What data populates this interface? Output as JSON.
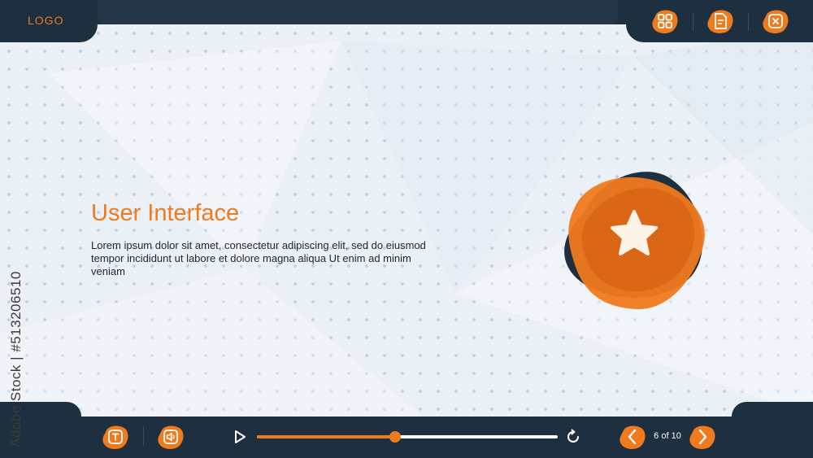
{
  "header": {
    "logo_text": "LOGO",
    "buttons": [
      {
        "name": "menu-grid-icon"
      },
      {
        "name": "document-icon"
      },
      {
        "name": "close-icon"
      }
    ]
  },
  "main": {
    "title": "User Interface",
    "body": "Lorem ipsum dolor sit amet, consectetur adipiscing elit, sed do eiusmod tempor incididunt ut labore et dolore magna aliqua Ut enim ad minim veniam",
    "hero_icon": "star-icon"
  },
  "controls": {
    "text_button_icon": "text-icon",
    "audio_button_icon": "speaker-icon",
    "progress_fraction": 0.46,
    "page_indicator": "6 of 10"
  },
  "watermark": {
    "stock_id": "Adobe Stock | #513206510"
  },
  "colors": {
    "accent": "#f07a1e",
    "frame": "#1e2f3f",
    "background": "#eaf0f6"
  }
}
